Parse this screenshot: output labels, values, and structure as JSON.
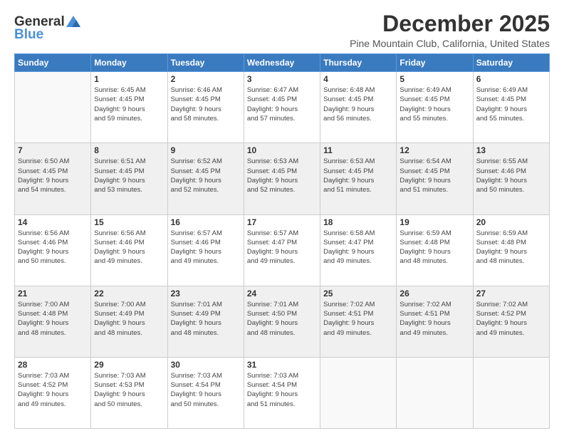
{
  "header": {
    "logo_general": "General",
    "logo_blue": "Blue",
    "title": "December 2025",
    "subtitle": "Pine Mountain Club, California, United States"
  },
  "calendar": {
    "days_of_week": [
      "Sunday",
      "Monday",
      "Tuesday",
      "Wednesday",
      "Thursday",
      "Friday",
      "Saturday"
    ],
    "weeks": [
      [
        {
          "day": "",
          "info": ""
        },
        {
          "day": "1",
          "info": "Sunrise: 6:45 AM\nSunset: 4:45 PM\nDaylight: 9 hours\nand 59 minutes."
        },
        {
          "day": "2",
          "info": "Sunrise: 6:46 AM\nSunset: 4:45 PM\nDaylight: 9 hours\nand 58 minutes."
        },
        {
          "day": "3",
          "info": "Sunrise: 6:47 AM\nSunset: 4:45 PM\nDaylight: 9 hours\nand 57 minutes."
        },
        {
          "day": "4",
          "info": "Sunrise: 6:48 AM\nSunset: 4:45 PM\nDaylight: 9 hours\nand 56 minutes."
        },
        {
          "day": "5",
          "info": "Sunrise: 6:49 AM\nSunset: 4:45 PM\nDaylight: 9 hours\nand 55 minutes."
        },
        {
          "day": "6",
          "info": "Sunrise: 6:49 AM\nSunset: 4:45 PM\nDaylight: 9 hours\nand 55 minutes."
        }
      ],
      [
        {
          "day": "7",
          "info": "Sunrise: 6:50 AM\nSunset: 4:45 PM\nDaylight: 9 hours\nand 54 minutes."
        },
        {
          "day": "8",
          "info": "Sunrise: 6:51 AM\nSunset: 4:45 PM\nDaylight: 9 hours\nand 53 minutes."
        },
        {
          "day": "9",
          "info": "Sunrise: 6:52 AM\nSunset: 4:45 PM\nDaylight: 9 hours\nand 52 minutes."
        },
        {
          "day": "10",
          "info": "Sunrise: 6:53 AM\nSunset: 4:45 PM\nDaylight: 9 hours\nand 52 minutes."
        },
        {
          "day": "11",
          "info": "Sunrise: 6:53 AM\nSunset: 4:45 PM\nDaylight: 9 hours\nand 51 minutes."
        },
        {
          "day": "12",
          "info": "Sunrise: 6:54 AM\nSunset: 4:45 PM\nDaylight: 9 hours\nand 51 minutes."
        },
        {
          "day": "13",
          "info": "Sunrise: 6:55 AM\nSunset: 4:46 PM\nDaylight: 9 hours\nand 50 minutes."
        }
      ],
      [
        {
          "day": "14",
          "info": "Sunrise: 6:56 AM\nSunset: 4:46 PM\nDaylight: 9 hours\nand 50 minutes."
        },
        {
          "day": "15",
          "info": "Sunrise: 6:56 AM\nSunset: 4:46 PM\nDaylight: 9 hours\nand 49 minutes."
        },
        {
          "day": "16",
          "info": "Sunrise: 6:57 AM\nSunset: 4:46 PM\nDaylight: 9 hours\nand 49 minutes."
        },
        {
          "day": "17",
          "info": "Sunrise: 6:57 AM\nSunset: 4:47 PM\nDaylight: 9 hours\nand 49 minutes."
        },
        {
          "day": "18",
          "info": "Sunrise: 6:58 AM\nSunset: 4:47 PM\nDaylight: 9 hours\nand 49 minutes."
        },
        {
          "day": "19",
          "info": "Sunrise: 6:59 AM\nSunset: 4:48 PM\nDaylight: 9 hours\nand 48 minutes."
        },
        {
          "day": "20",
          "info": "Sunrise: 6:59 AM\nSunset: 4:48 PM\nDaylight: 9 hours\nand 48 minutes."
        }
      ],
      [
        {
          "day": "21",
          "info": "Sunrise: 7:00 AM\nSunset: 4:48 PM\nDaylight: 9 hours\nand 48 minutes."
        },
        {
          "day": "22",
          "info": "Sunrise: 7:00 AM\nSunset: 4:49 PM\nDaylight: 9 hours\nand 48 minutes."
        },
        {
          "day": "23",
          "info": "Sunrise: 7:01 AM\nSunset: 4:49 PM\nDaylight: 9 hours\nand 48 minutes."
        },
        {
          "day": "24",
          "info": "Sunrise: 7:01 AM\nSunset: 4:50 PM\nDaylight: 9 hours\nand 48 minutes."
        },
        {
          "day": "25",
          "info": "Sunrise: 7:02 AM\nSunset: 4:51 PM\nDaylight: 9 hours\nand 49 minutes."
        },
        {
          "day": "26",
          "info": "Sunrise: 7:02 AM\nSunset: 4:51 PM\nDaylight: 9 hours\nand 49 minutes."
        },
        {
          "day": "27",
          "info": "Sunrise: 7:02 AM\nSunset: 4:52 PM\nDaylight: 9 hours\nand 49 minutes."
        }
      ],
      [
        {
          "day": "28",
          "info": "Sunrise: 7:03 AM\nSunset: 4:52 PM\nDaylight: 9 hours\nand 49 minutes."
        },
        {
          "day": "29",
          "info": "Sunrise: 7:03 AM\nSunset: 4:53 PM\nDaylight: 9 hours\nand 50 minutes."
        },
        {
          "day": "30",
          "info": "Sunrise: 7:03 AM\nSunset: 4:54 PM\nDaylight: 9 hours\nand 50 minutes."
        },
        {
          "day": "31",
          "info": "Sunrise: 7:03 AM\nSunset: 4:54 PM\nDaylight: 9 hours\nand 51 minutes."
        },
        {
          "day": "",
          "info": ""
        },
        {
          "day": "",
          "info": ""
        },
        {
          "day": "",
          "info": ""
        }
      ]
    ]
  }
}
